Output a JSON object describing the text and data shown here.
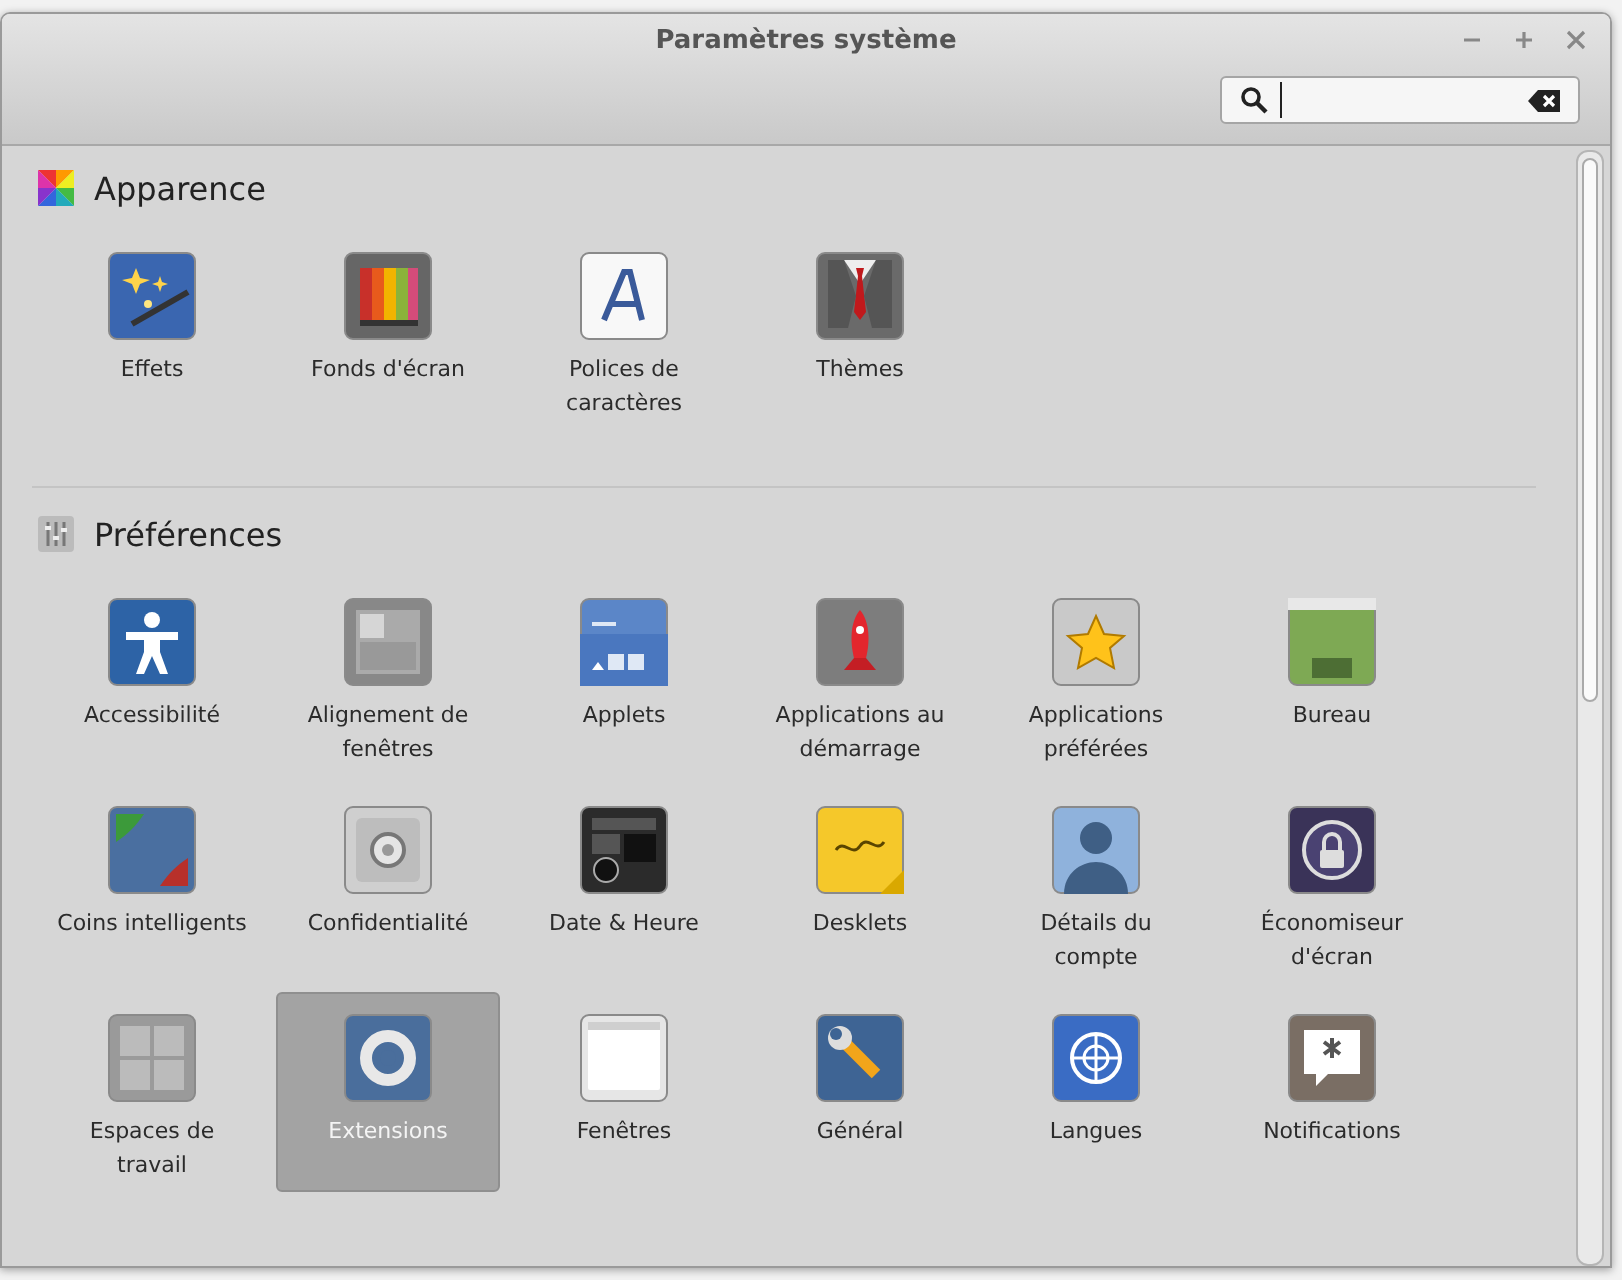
{
  "window": {
    "title": "Paramètres système"
  },
  "sections": [
    {
      "title": "Apparence",
      "items": [
        {
          "label": "Effets",
          "selected": false
        },
        {
          "label": "Fonds d'écran",
          "selected": false
        },
        {
          "label": "Polices de caractères",
          "selected": false
        },
        {
          "label": "Thèmes",
          "selected": false
        }
      ]
    },
    {
      "title": "Préférences",
      "items": [
        {
          "label": "Accessibilité",
          "selected": false
        },
        {
          "label": "Alignement de fenêtres",
          "selected": false
        },
        {
          "label": "Applets",
          "selected": false
        },
        {
          "label": "Applications au démarrage",
          "selected": false
        },
        {
          "label": "Applications préférées",
          "selected": false
        },
        {
          "label": "Bureau",
          "selected": false
        },
        {
          "label": "Coins intelligents",
          "selected": false
        },
        {
          "label": "Confidentialité",
          "selected": false
        },
        {
          "label": "Date & Heure",
          "selected": false
        },
        {
          "label": "Desklets",
          "selected": false
        },
        {
          "label": "Détails du compte",
          "selected": false
        },
        {
          "label": "Économiseur d'écran",
          "selected": false
        },
        {
          "label": "Espaces de travail",
          "selected": false
        },
        {
          "label": "Extensions",
          "selected": true
        },
        {
          "label": "Fenêtres",
          "selected": false
        },
        {
          "label": "Général",
          "selected": false
        },
        {
          "label": "Langues",
          "selected": false
        },
        {
          "label": "Notifications",
          "selected": false
        }
      ]
    }
  ]
}
